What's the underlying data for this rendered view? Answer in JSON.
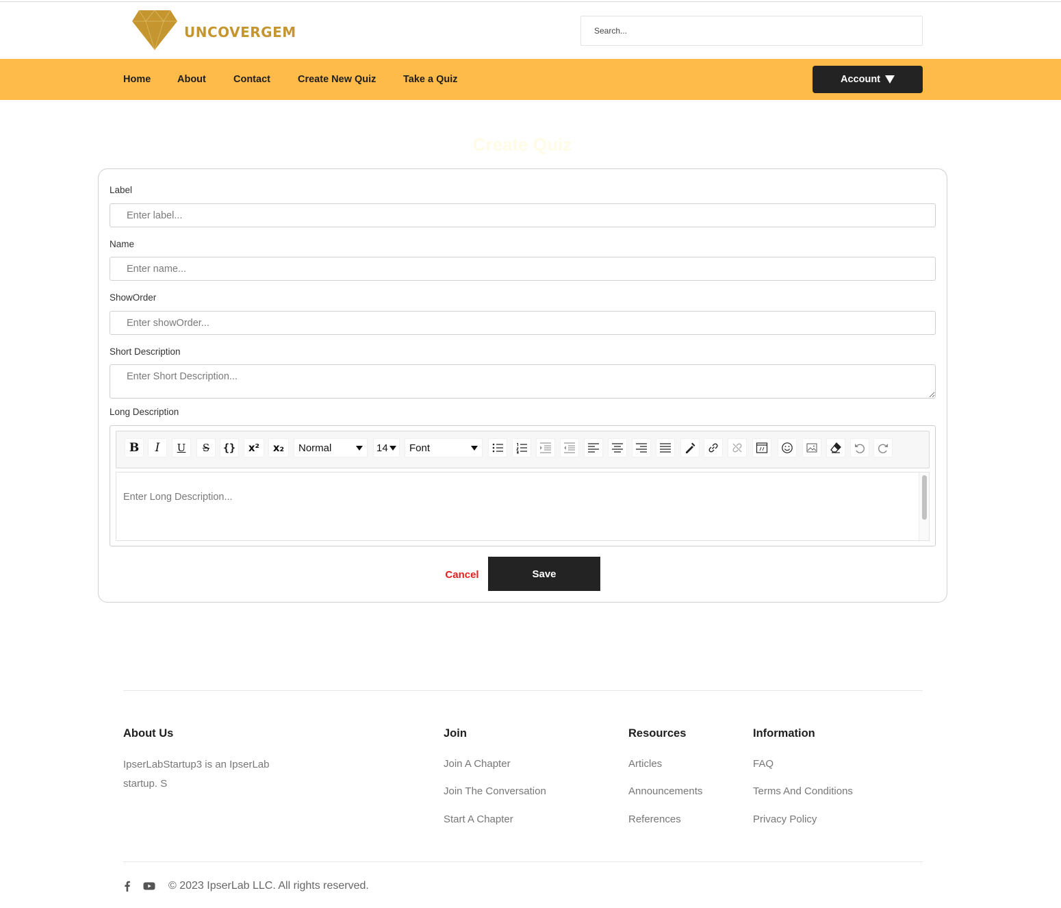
{
  "brand": {
    "name": "UNCOVERGEM",
    "color": "#c5962f",
    "logo_icon": "diamond-icon"
  },
  "header": {
    "search_placeholder": "Search..."
  },
  "nav": {
    "background": "#ffbb4a",
    "items": [
      "Home",
      "About",
      "Contact",
      "Create New Quiz",
      "Take a Quiz"
    ],
    "account_label": "Account",
    "account_bg": "#232323"
  },
  "page": {
    "title": "Create Quiz",
    "title_color": "#fffbe6"
  },
  "form": {
    "label": {
      "label": "Label",
      "placeholder": "Enter label..."
    },
    "name": {
      "label": "Name",
      "placeholder": "Enter name..."
    },
    "show_order": {
      "label": "ShowOrder",
      "placeholder": "Enter showOrder..."
    },
    "short_description": {
      "label": "Short Description",
      "placeholder": "Enter Short Description..."
    },
    "long_description": {
      "label": "Long Description",
      "placeholder": "Enter Long Description...",
      "toolbar": {
        "block_format": "Normal",
        "font_size": "14",
        "font_family": "Font",
        "icons": [
          "bold-icon",
          "italic-icon",
          "underline-icon",
          "strikethrough-icon",
          "code-icon",
          "superscript-icon",
          "subscript-icon",
          "unordered-list-icon",
          "ordered-list-icon",
          "indent-icon",
          "outdent-icon",
          "align-left-icon",
          "align-center-icon",
          "align-right-icon",
          "align-justify-icon",
          "color-picker-icon",
          "link-icon",
          "unlink-icon",
          "embed-icon",
          "emoji-icon",
          "image-icon",
          "eraser-icon",
          "undo-icon",
          "redo-icon"
        ]
      }
    },
    "cancel_label": "Cancel",
    "save_label": "Save",
    "cancel_color": "#e02020",
    "save_bg": "#232323"
  },
  "footer": {
    "about": {
      "heading": "About Us",
      "text": "IpserLabStartup3 is an IpserLab startup. S"
    },
    "join": {
      "heading": "Join",
      "links": [
        "Join A Chapter",
        "Join The Conversation",
        "Start A Chapter"
      ]
    },
    "resources": {
      "heading": "Resources",
      "links": [
        "Articles",
        "Announcements",
        "References"
      ]
    },
    "information": {
      "heading": "Information",
      "links": [
        "FAQ",
        "Terms And Conditions",
        "Privacy Policy"
      ]
    },
    "social_icons": [
      "facebook-icon",
      "youtube-icon"
    ],
    "copyright": "© 2023 IpserLab LLC. All rights reserved."
  }
}
